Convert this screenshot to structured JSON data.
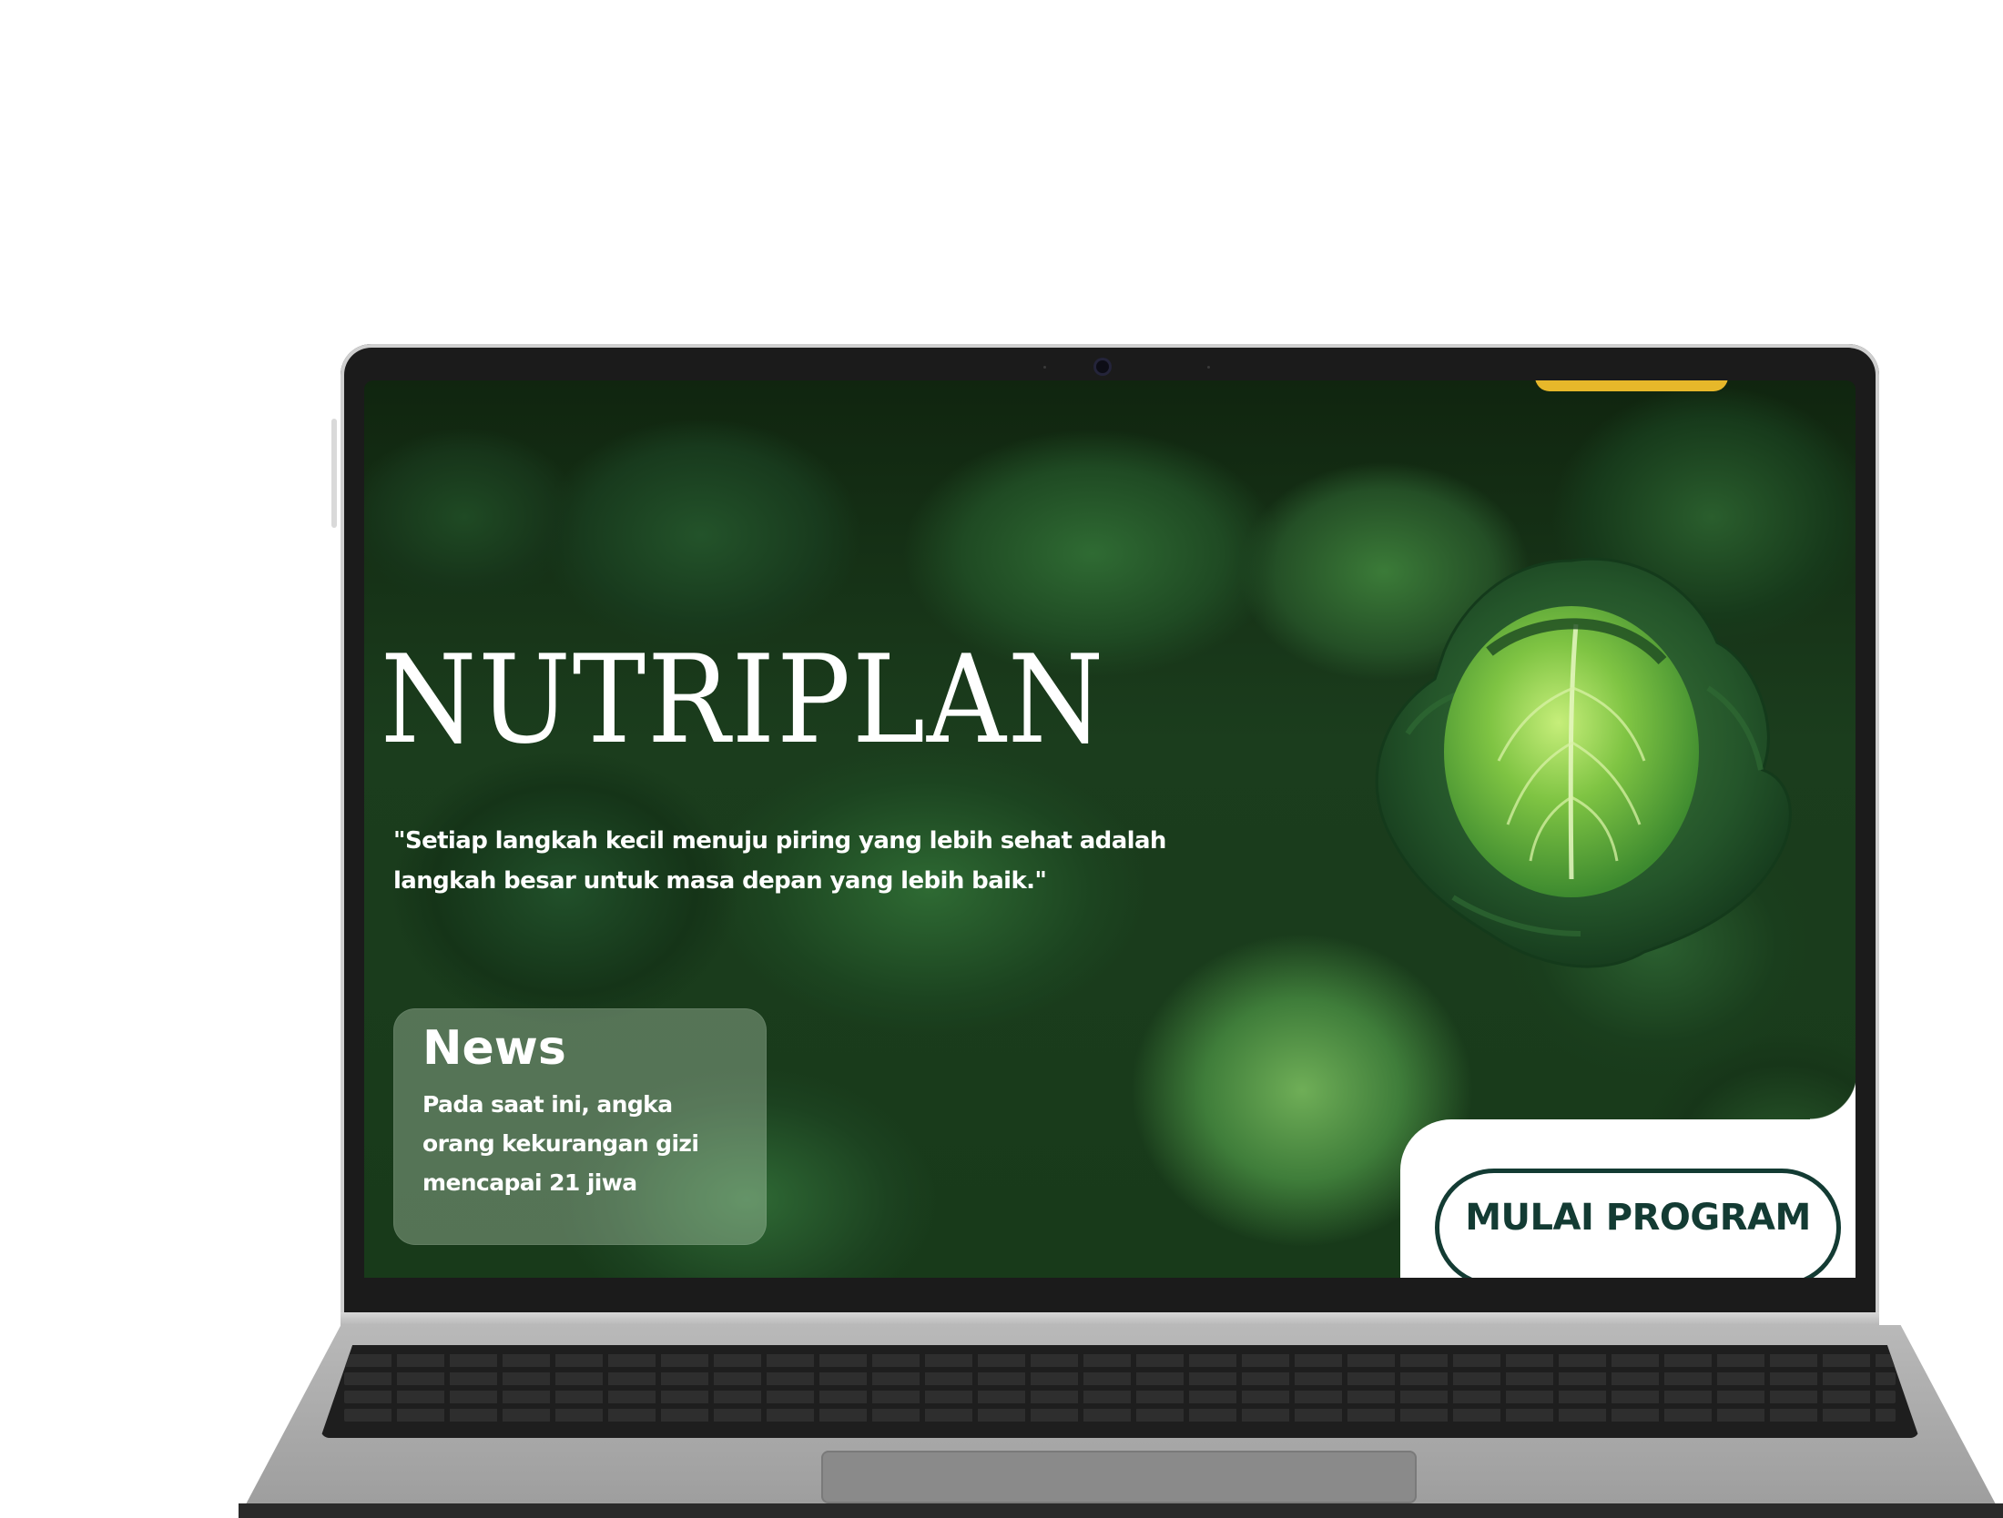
{
  "hero": {
    "brand": "NUTRIPLAN",
    "quote": "\"Setiap langkah kecil menuju piring yang lebih sehat adalah langkah besar untuk masa depan yang lebih baik.\""
  },
  "news": {
    "title": "News",
    "text": "Pada saat ini, angka orang kekurangan gizi mencapai 21 jiwa"
  },
  "cta": {
    "label": "MULAI PROGRAM"
  },
  "icons": {
    "hero_image": "cabbage-illustration",
    "webcam": "webcam-icon"
  },
  "colors": {
    "accent_dark_green": "#133b33",
    "accent_yellow": "#e7b82a",
    "text_light": "#ffffff"
  }
}
